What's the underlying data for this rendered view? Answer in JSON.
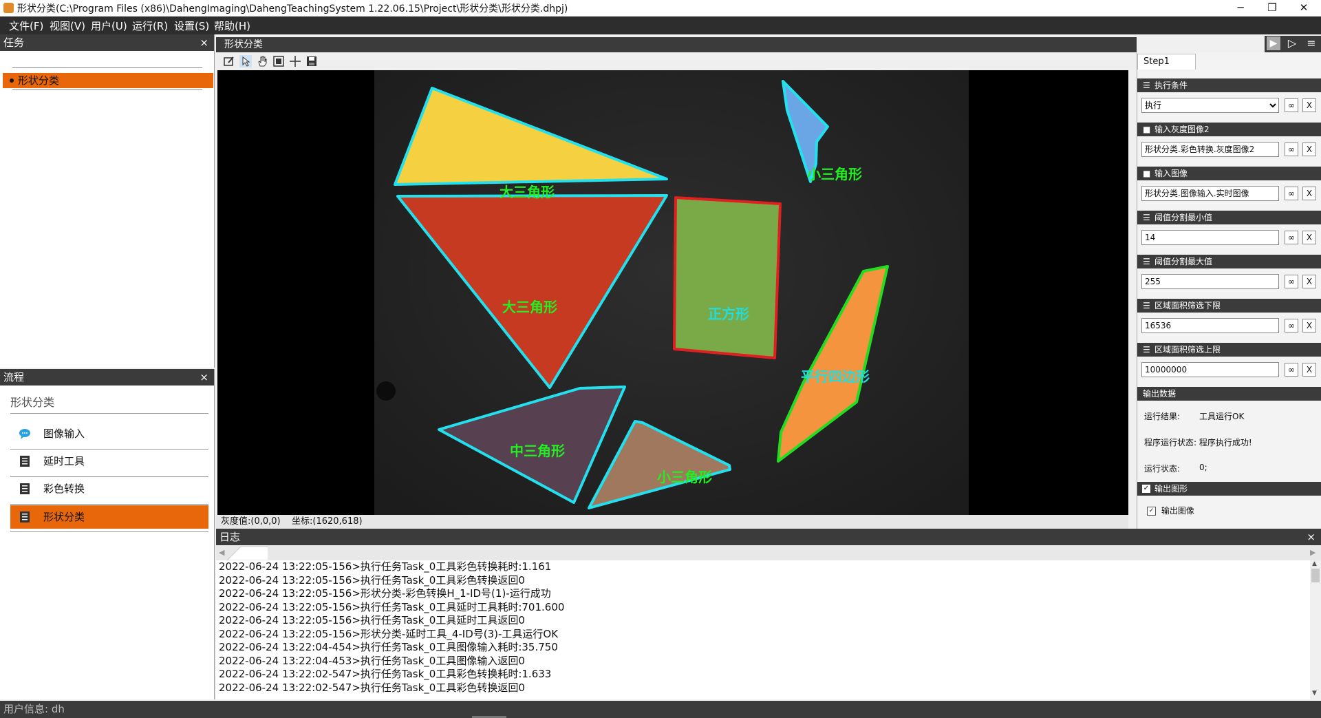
{
  "window": {
    "title": "形状分类(C:\\Program Files (x86)\\DahengImaging\\DahengTeachingSystem 1.22.06.15\\Project\\形状分类\\形状分类.dhpj)",
    "minimize": "─",
    "maximize": "❐",
    "close": "✕"
  },
  "menu": [
    "文件(F)",
    "视图(V)",
    "用户(U)",
    "运行(R)",
    "设置(S)",
    "帮助(H)"
  ],
  "task_panel": {
    "title": "任务",
    "close": "×",
    "items": [
      "形状分类"
    ]
  },
  "flow_panel": {
    "title": "流程",
    "close": "×",
    "task_name": "形状分类",
    "items": [
      {
        "label": "图像输入",
        "icon": "image-input-icon",
        "selected": false
      },
      {
        "label": "延时工具",
        "icon": "tool-doc-icon",
        "selected": false
      },
      {
        "label": "彩色转换",
        "icon": "tool-doc-icon",
        "selected": false
      },
      {
        "label": "形状分类",
        "icon": "tool-doc-icon",
        "selected": true
      }
    ]
  },
  "image_view": {
    "tab_title": "形状分类",
    "toolbar": [
      "edit-icon",
      "pointer-icon",
      "hand-icon",
      "fit-icon",
      "crosshair-icon",
      "save-icon"
    ],
    "status_gray": "灰度值:(0,0,0)",
    "status_coord": "坐标:(1620,618)",
    "shape_labels": {
      "big1": "大三角形",
      "big2": "大三角形",
      "small1": "小三角形",
      "square": "正方形",
      "para": "平行四边形",
      "mid": "中三角形",
      "small2": "小三角形"
    },
    "colors": {
      "outline_cyan": "#22e0ee",
      "outline_red": "#e02020",
      "outline_green": "#22dd22",
      "label_green": "#22ee22",
      "label_cyan": "#22dddd",
      "yellow": "#f5d040",
      "red": "#c63a22",
      "blue": "#6aa6e6",
      "green": "#7aaa48",
      "orange": "#f5943e",
      "purple": "#574050",
      "wood": "#a0785e"
    }
  },
  "run_controls": {
    "run": "▶",
    "run_once": "▷",
    "menu": "≡"
  },
  "right_panel": {
    "step_tab": "Step1",
    "sections": [
      {
        "title": "执行条件",
        "value": "执行",
        "type": "select"
      },
      {
        "title": "输入灰度图像2",
        "value": "形状分类.彩色转换.灰度图像2",
        "type": "text"
      },
      {
        "title": "输入图像",
        "value": "形状分类.图像输入.实时图像",
        "type": "text"
      },
      {
        "title": "阈值分割最小值",
        "value": "14",
        "type": "text"
      },
      {
        "title": "阈值分割最大值",
        "value": "255",
        "type": "text"
      },
      {
        "title": "区域面积筛选下限",
        "value": "16536",
        "type": "text"
      },
      {
        "title": "区域面积筛选上限",
        "value": "10000000",
        "type": "text"
      }
    ],
    "link_btn": "∞",
    "clear_btn": "X",
    "output_data": {
      "title": "输出数据",
      "run_result_label": "运行结果:",
      "run_result_value": "工具运行OK",
      "program_state_label": "程序运行状态:",
      "program_state_value": "程序执行成功!",
      "run_state_label": "运行状态:",
      "run_state_value": "0;"
    },
    "output_graphics": {
      "title": "输出图形",
      "option": "输出图像"
    }
  },
  "log": {
    "title": "日志",
    "close": "×",
    "lines": [
      "2022-06-24 13:22:05-156>执行任务Task_0工具彩色转换耗时:1.161",
      "2022-06-24 13:22:05-156>执行任务Task_0工具彩色转换返回0",
      "2022-06-24 13:22:05-156>形状分类-彩色转换H_1-ID号(1)-运行成功",
      "2022-06-24 13:22:05-156>执行任务Task_0工具延时工具耗时:701.600",
      "2022-06-24 13:22:05-156>执行任务Task_0工具延时工具返回0",
      "2022-06-24 13:22:05-156>形状分类-延时工具_4-ID号(3)-工具运行OK",
      "2022-06-24 13:22:04-454>执行任务Task_0工具图像输入耗时:35.750",
      "2022-06-24 13:22:04-453>执行任务Task_0工具图像输入返回0",
      "2022-06-24 13:22:02-547>执行任务Task_0工具彩色转换耗时:1.633",
      "2022-06-24 13:22:02-547>执行任务Task_0工具彩色转换返回0"
    ]
  },
  "statusbar": {
    "user_info": "用户信息: dh"
  }
}
